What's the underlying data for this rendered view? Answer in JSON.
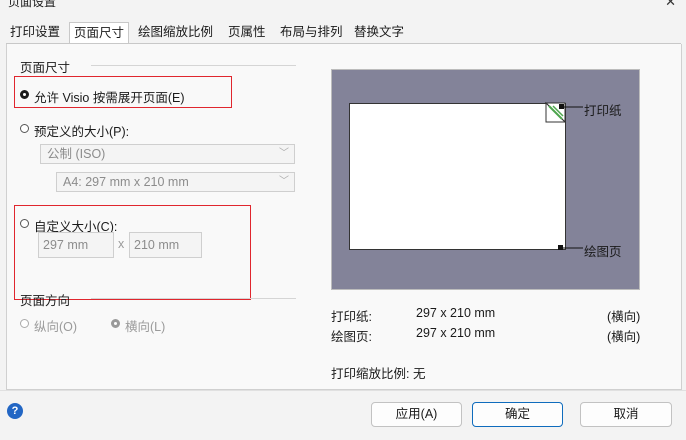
{
  "window": {
    "title": "页面设置",
    "close_glyph": "✕"
  },
  "tabs": [
    {
      "label": "打印设置",
      "active": false
    },
    {
      "label": "页面尺寸",
      "active": true
    },
    {
      "label": "绘图缩放比例",
      "active": false
    },
    {
      "label": "页属性",
      "active": false
    },
    {
      "label": "布局与排列",
      "active": false
    },
    {
      "label": "替换文字",
      "active": false
    }
  ],
  "page_size": {
    "group_label": "页面尺寸",
    "option_auto": {
      "label": "允许 Visio 按需展开页面(E)",
      "selected": true
    },
    "option_predefined": {
      "label": "预定义的大小(P):",
      "selected": false,
      "unit_select": "公制 (ISO)",
      "size_select": "A4:  297 mm x 210 mm"
    },
    "option_custom": {
      "label": "自定义大小(C):",
      "selected": false,
      "width": "297 mm",
      "separator": "x",
      "height": "210 mm"
    }
  },
  "orientation": {
    "group_label": "页面方向",
    "portrait": {
      "label": "纵向(O)",
      "selected": false
    },
    "landscape": {
      "label": "横向(L)",
      "selected": true
    }
  },
  "preview": {
    "printer_paper_label": "打印纸",
    "drawing_page_label": "绘图页",
    "background_color": "#838399"
  },
  "stats": {
    "paper_key": "打印纸:",
    "paper_value": "297 x 210 mm",
    "paper_orient": "(横向)",
    "page_key": "绘图页:",
    "page_value": "297 x 210 mm",
    "page_orient": "(横向)",
    "scale_text": "打印缩放比例: 无"
  },
  "footer": {
    "help_glyph": "?",
    "apply_label": "应用(A)",
    "ok_label": "确定",
    "cancel_label": "取消"
  },
  "colors": {
    "accent": "#0f6cbd",
    "highlight_box": "#e0262e",
    "help_icon": "#2266c4"
  }
}
